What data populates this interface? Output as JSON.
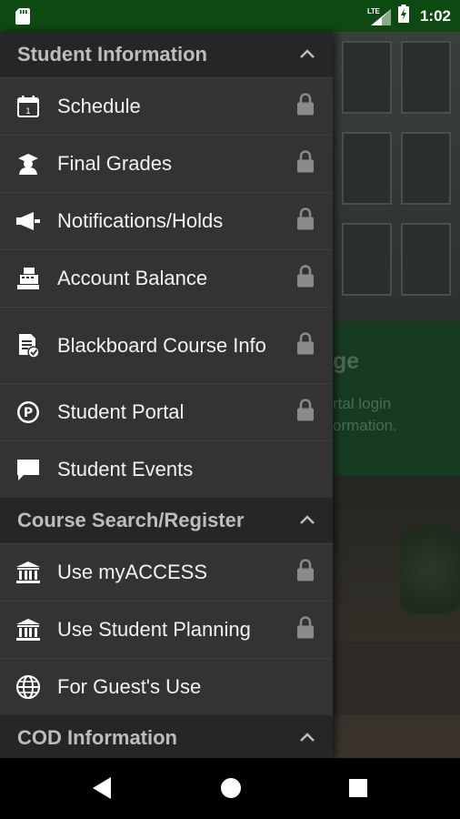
{
  "status_bar": {
    "network_label": "LTE",
    "time": "1:02",
    "icons": [
      "sd-card-icon",
      "lte-signal-icon",
      "battery-charging-icon"
    ]
  },
  "background": {
    "heading_fragment": "ge",
    "text_line1": "rtal login",
    "text_line2": "ormation."
  },
  "drawer": {
    "sections": [
      {
        "title": "Student Information",
        "items": [
          {
            "label": "Schedule",
            "icon": "calendar-icon",
            "locked": true
          },
          {
            "label": "Final Grades",
            "icon": "graduate-icon",
            "locked": true
          },
          {
            "label": "Notifications/Holds",
            "icon": "megaphone-icon",
            "locked": true
          },
          {
            "label": "Account Balance",
            "icon": "cash-register-icon",
            "locked": true
          },
          {
            "label": "Blackboard Course Info",
            "icon": "document-check-icon",
            "locked": true
          },
          {
            "label": "Student Portal",
            "icon": "parking-p-icon",
            "locked": true
          },
          {
            "label": "Student Events",
            "icon": "chat-bubble-icon",
            "locked": false
          }
        ]
      },
      {
        "title": "Course Search/Register",
        "items": [
          {
            "label": "Use myACCESS",
            "icon": "institution-icon",
            "locked": true
          },
          {
            "label": "Use Student Planning",
            "icon": "institution-icon",
            "locked": true
          },
          {
            "label": "For Guest's Use",
            "icon": "globe-icon",
            "locked": false
          }
        ]
      },
      {
        "title": "COD Information",
        "items": []
      }
    ]
  },
  "nav_bar": {
    "icons": [
      "back-icon",
      "home-icon",
      "recents-icon"
    ]
  }
}
